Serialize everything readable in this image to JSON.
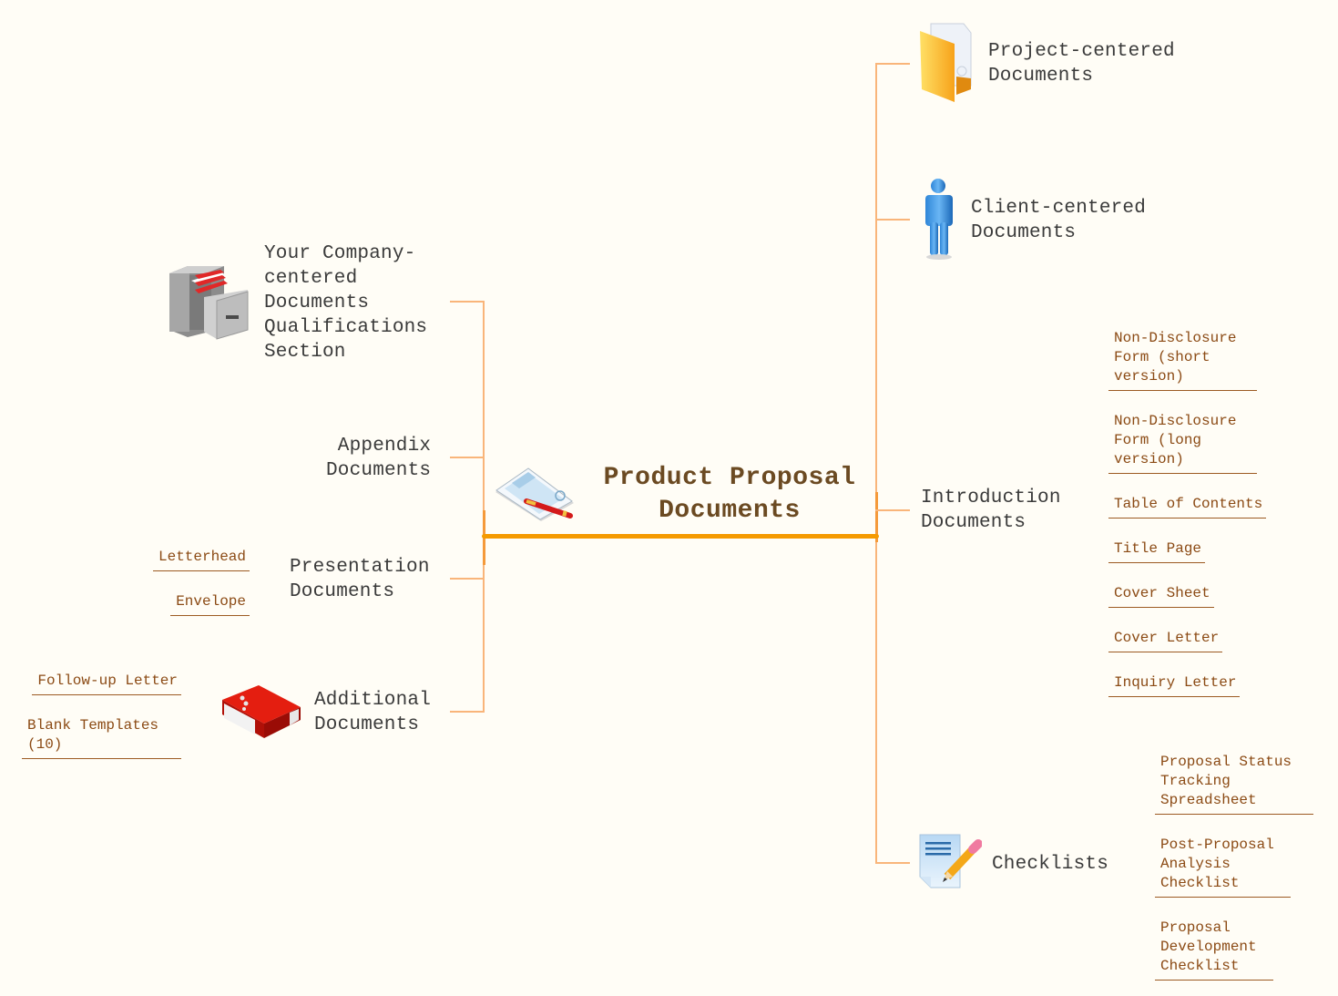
{
  "central": {
    "title": "Product Proposal\nDocuments",
    "icon": "proposal-document-pen-icon"
  },
  "colors": {
    "background": "#fffdf6",
    "main_bar": "#f59a00",
    "connector": "#f9b57a",
    "topic_text": "#3a3a3a",
    "central_text": "#6b4a22",
    "subtopic_text": "#8b4a14"
  },
  "left_branches": [
    {
      "label": "Your Company-\ncentered\nDocuments\nQualifications\nSection",
      "icon": "file-cabinet-icon",
      "subtopics": []
    },
    {
      "label": "Appendix\nDocuments",
      "icon": null,
      "subtopics": []
    },
    {
      "label": "Presentation\nDocuments",
      "icon": null,
      "subtopics": [
        "Letterhead",
        "Envelope"
      ]
    },
    {
      "label": "Additional\nDocuments",
      "icon": "red-binder-icon",
      "subtopics": [
        "Follow-up Letter",
        "Blank Templates\n(10)"
      ]
    }
  ],
  "right_branches": [
    {
      "label": "Project-centered\nDocuments",
      "icon": "folder-icon",
      "subtopics": []
    },
    {
      "label": "Client-centered\nDocuments",
      "icon": "person-icon",
      "subtopics": []
    },
    {
      "label": "Introduction\nDocuments",
      "icon": null,
      "subtopics": [
        "Non-Disclosure\nForm (short\nversion)",
        "Non-Disclosure\nForm (long\nversion)",
        "Table of Contents",
        "Title Page",
        "Cover Sheet",
        "Cover Letter",
        "Inquiry Letter"
      ]
    },
    {
      "label": "Checklists",
      "icon": "checklist-pencil-icon",
      "subtopics": [
        "Proposal Status\nTracking\nSpreadsheet",
        "Post-Proposal\nAnalysis\nChecklist",
        "Proposal\nDevelopment\nChecklist"
      ]
    }
  ]
}
